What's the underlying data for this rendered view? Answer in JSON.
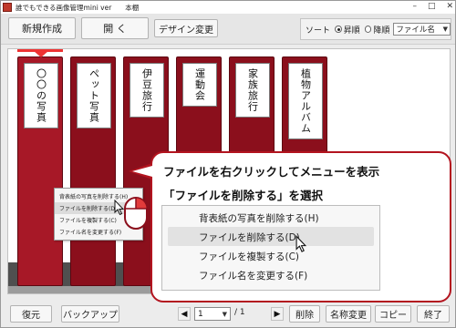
{
  "window": {
    "title": "誰でもできる画像管理mini ver　　本棚",
    "controls": [
      "–",
      "□",
      "✕"
    ]
  },
  "toolbar": {
    "new_label": "新規作成",
    "open_label": "開 く",
    "design_label": "デザイン変更",
    "sort_label": "ソート",
    "asc_label": "昇順",
    "desc_label": "降順",
    "sort_field": "ファイル名"
  },
  "shelf": {
    "binders": [
      {
        "label": "〇〇の写真",
        "selected": true
      },
      {
        "label": "ペット写真",
        "selected": false
      },
      {
        "label": "伊豆旅行",
        "selected": false
      },
      {
        "label": "運動会",
        "selected": false
      },
      {
        "label": "家族旅行",
        "selected": false
      },
      {
        "label": "植物アルバム",
        "selected": false
      }
    ]
  },
  "context_menu_small": {
    "items": [
      "背表紙の写真を削除する(H)",
      "ファイルを削除する(D)",
      "ファイルを複製する(C)",
      "ファイル名を変更する(F)"
    ]
  },
  "callout": {
    "line1": "ファイルを右クリックしてメニューを表示",
    "line2": "「ファイルを削除する」を選択",
    "menu_items": [
      "背表紙の写真を削除する(H)",
      "ファイルを削除する(D)",
      "ファイルを複製する(C)",
      "ファイル名を変更する(F)"
    ]
  },
  "bottombar": {
    "restore_label": "復元",
    "backup_label": "バックアップ",
    "page_current": "1",
    "page_total": "/ 1",
    "delete_label": "削除",
    "rename_label": "名称変更",
    "copy_label": "コピー",
    "exit_label": "終了"
  },
  "colors": {
    "binder": "#8b0f1c",
    "accent": "#b3141f",
    "shelf_dark": "#4f4f4f"
  }
}
